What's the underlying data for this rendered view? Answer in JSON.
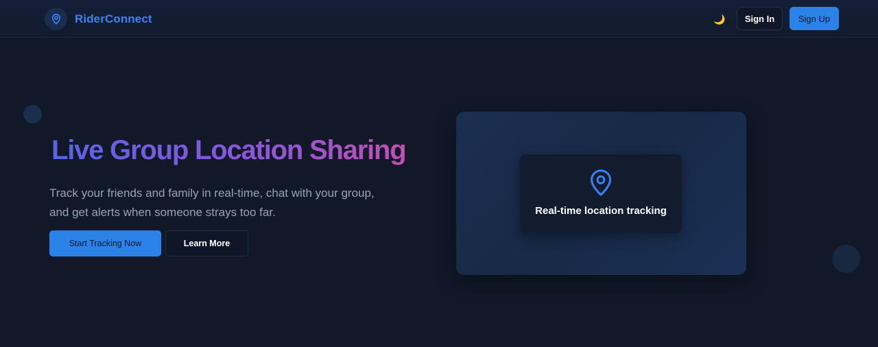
{
  "navbar": {
    "brand_name": "RiderConnect",
    "brand_icon": "map-pin-icon",
    "theme_toggle_icon": "moon-icon",
    "theme_toggle_glyph": "🌙",
    "signin_label": "Sign In",
    "signup_label": "Sign Up"
  },
  "hero": {
    "title": "Live Group Location Sharing",
    "subtitle": "Track your friends and family in real-time, chat with your group, and get alerts when someone strays too far.",
    "primary_cta": "Start Tracking Now",
    "secondary_cta": "Learn More"
  },
  "feature_card": {
    "icon": "map-pin-icon",
    "label": "Real-time location tracking"
  },
  "colors": {
    "background": "#111828",
    "accent": "#2b83ea",
    "brand_text": "#3b82f6",
    "title_gradient": [
      "#5a63e6",
      "#8a57dc",
      "#c34eb5"
    ]
  }
}
